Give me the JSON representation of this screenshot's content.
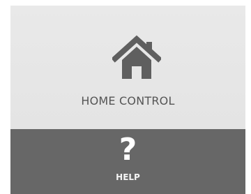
{
  "tiles": {
    "home": {
      "label": "HOME CONTROL",
      "icon": "home-icon",
      "background": "#e6e6e6",
      "icon_color": "#5f5f5f"
    },
    "help": {
      "label": "HELP",
      "icon_glyph": "?",
      "icon": "question-mark-icon",
      "background": "#676767",
      "text_color": "#ffffff"
    }
  }
}
